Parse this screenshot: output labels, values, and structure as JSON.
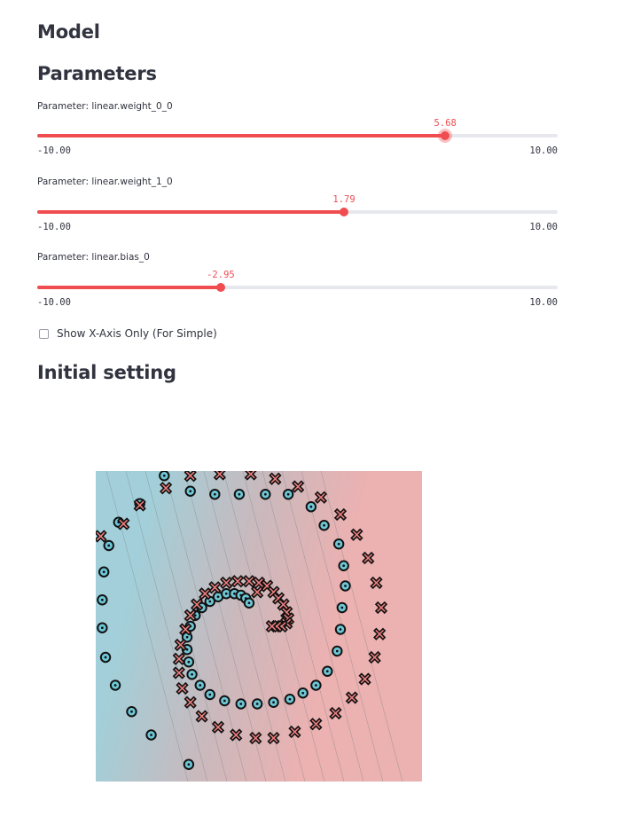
{
  "model_heading": "Model",
  "parameters_heading": "Parameters",
  "sliders": [
    {
      "label": "Parameter: linear.weight_0_0",
      "value": 5.68,
      "value_text": "5.68",
      "min": -10,
      "max": 10,
      "min_text": "-10.00",
      "max_text": "10.00",
      "active": true
    },
    {
      "label": "Parameter: linear.weight_1_0",
      "value": 1.79,
      "value_text": "1.79",
      "min": -10,
      "max": 10,
      "min_text": "-10.00",
      "max_text": "10.00",
      "active": false
    },
    {
      "label": "Parameter: linear.bias_0",
      "value": -2.95,
      "value_text": "-2.95",
      "min": -10,
      "max": 10,
      "min_text": "-10.00",
      "max_text": "10.00",
      "active": false
    }
  ],
  "checkbox": {
    "label": "Show X-Axis Only (For Simple)",
    "checked": false
  },
  "initial_heading": "Initial setting",
  "colors": {
    "accent": "#f04d51",
    "class_a_background": "#a2cfd9",
    "class_b_background": "#ecb1b1",
    "class_a_marker": "#6ec7d6",
    "class_b_marker": "#f07f7f"
  },
  "chart_data": {
    "type": "scatter",
    "title": "",
    "xlabel": "",
    "ylabel": "",
    "xlim": [
      -1,
      1
    ],
    "ylim": [
      -1,
      1
    ],
    "grid": false,
    "legend": "none",
    "background": "decision-boundary contour from cyan (left) to red (right)",
    "series": [
      {
        "marker": "circle-dot",
        "color": "#6ec7d6",
        "points": [
          [
            -0.58,
            0.97
          ],
          [
            -0.42,
            0.87
          ],
          [
            -0.27,
            0.85
          ],
          [
            -0.12,
            0.85
          ],
          [
            0.04,
            0.85
          ],
          [
            0.18,
            0.85
          ],
          [
            0.32,
            0.77
          ],
          [
            0.4,
            0.65
          ],
          [
            0.49,
            0.53
          ],
          [
            0.52,
            0.39
          ],
          [
            0.53,
            0.26
          ],
          [
            0.51,
            0.12
          ],
          [
            0.5,
            -0.02
          ],
          [
            0.48,
            -0.16
          ],
          [
            0.42,
            -0.29
          ],
          [
            0.35,
            -0.38
          ],
          [
            0.27,
            -0.43
          ],
          [
            0.19,
            -0.47
          ],
          [
            0.09,
            -0.49
          ],
          [
            -0.01,
            -0.5
          ],
          [
            -0.11,
            -0.5
          ],
          [
            -0.21,
            -0.48
          ],
          [
            -0.3,
            -0.44
          ],
          [
            -0.36,
            -0.38
          ],
          [
            -0.41,
            -0.31
          ],
          [
            -0.43,
            -0.23
          ],
          [
            -0.44,
            -0.15
          ],
          [
            -0.44,
            -0.07
          ],
          [
            -0.42,
            0.0
          ],
          [
            -0.39,
            0.07
          ],
          [
            -0.35,
            0.12
          ],
          [
            -0.3,
            0.16
          ],
          [
            -0.25,
            0.19
          ],
          [
            -0.2,
            0.21
          ],
          [
            -0.15,
            0.21
          ],
          [
            -0.11,
            0.2
          ],
          [
            -0.08,
            0.18
          ],
          [
            -0.06,
            0.15
          ],
          [
            -0.73,
            0.79
          ],
          [
            -0.86,
            0.67
          ],
          [
            -0.92,
            0.52
          ],
          [
            -0.95,
            0.35
          ],
          [
            -0.96,
            0.17
          ],
          [
            -0.96,
            -0.01
          ],
          [
            -0.94,
            -0.2
          ],
          [
            -0.88,
            -0.38
          ],
          [
            -0.78,
            -0.55
          ],
          [
            -0.66,
            -0.7
          ],
          [
            -0.43,
            -0.89
          ]
        ]
      },
      {
        "marker": "x",
        "color": "#f07f7f",
        "points": [
          [
            -0.83,
            0.66
          ],
          [
            -0.73,
            0.78
          ],
          [
            -0.57,
            0.89
          ],
          [
            -0.42,
            0.97
          ],
          [
            -0.24,
            0.98
          ],
          [
            -0.05,
            0.98
          ],
          [
            0.1,
            0.95
          ],
          [
            0.24,
            0.9
          ],
          [
            0.38,
            0.83
          ],
          [
            0.5,
            0.72
          ],
          [
            0.6,
            0.59
          ],
          [
            0.67,
            0.44
          ],
          [
            0.72,
            0.28
          ],
          [
            0.75,
            0.12
          ],
          [
            0.74,
            -0.05
          ],
          [
            0.71,
            -0.2
          ],
          [
            0.65,
            -0.34
          ],
          [
            0.57,
            -0.46
          ],
          [
            0.47,
            -0.56
          ],
          [
            0.35,
            -0.63
          ],
          [
            0.22,
            -0.68
          ],
          [
            0.09,
            -0.72
          ],
          [
            -0.02,
            -0.72
          ],
          [
            -0.14,
            -0.7
          ],
          [
            -0.25,
            -0.65
          ],
          [
            -0.35,
            -0.58
          ],
          [
            -0.42,
            -0.49
          ],
          [
            -0.47,
            -0.4
          ],
          [
            -0.49,
            -0.3
          ],
          [
            -0.49,
            -0.21
          ],
          [
            -0.48,
            -0.12
          ],
          [
            -0.45,
            -0.02
          ],
          [
            -0.42,
            0.07
          ],
          [
            -0.38,
            0.14
          ],
          [
            -0.33,
            0.21
          ],
          [
            -0.27,
            0.25
          ],
          [
            -0.2,
            0.28
          ],
          [
            -0.13,
            0.29
          ],
          [
            -0.06,
            0.29
          ],
          [
            0.0,
            0.28
          ],
          [
            0.05,
            0.26
          ],
          [
            0.09,
            0.22
          ],
          [
            0.12,
            0.18
          ],
          [
            0.15,
            0.14
          ],
          [
            0.17,
            0.09
          ],
          [
            0.18,
            0.05
          ],
          [
            0.17,
            0.02
          ],
          [
            0.14,
            0.0
          ],
          [
            0.11,
            0.0
          ],
          [
            0.08,
            0.0
          ],
          [
            -0.01,
            0.22
          ],
          [
            -0.97,
            0.58
          ]
        ]
      }
    ]
  }
}
